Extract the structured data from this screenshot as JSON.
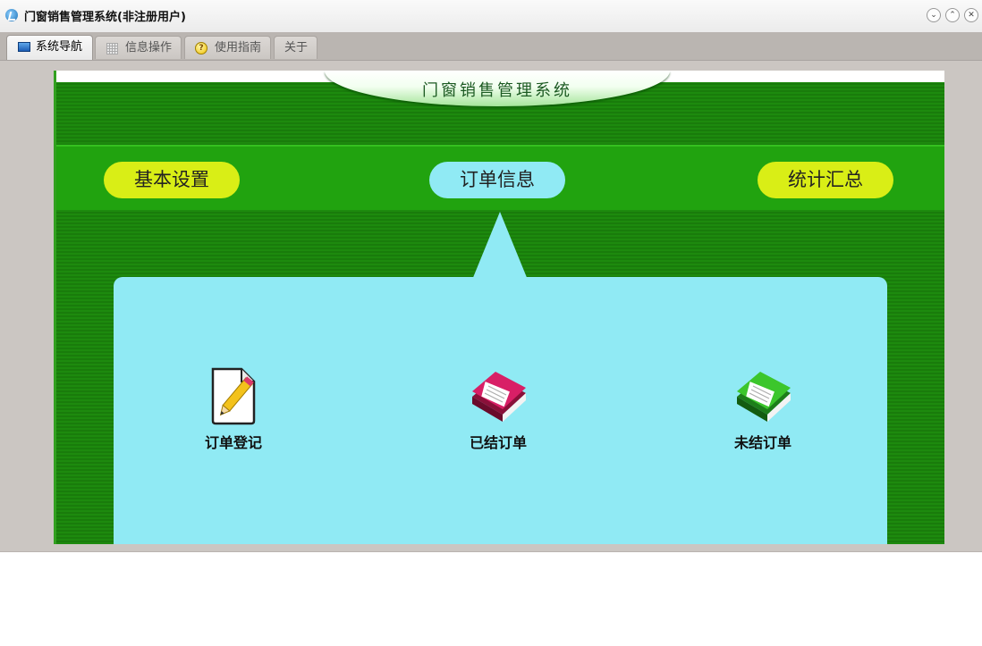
{
  "window": {
    "title": "门窗销售管理系统(非注册用户)"
  },
  "window_controls": [
    {
      "name": "minimize",
      "glyph": "⌄"
    },
    {
      "name": "maximize",
      "glyph": "⌃"
    },
    {
      "name": "close",
      "glyph": "✕"
    }
  ],
  "tabs": [
    {
      "label": "系统导航",
      "icon": "monitor-icon",
      "active": true
    },
    {
      "label": "信息操作",
      "icon": "grid-icon",
      "active": false
    },
    {
      "label": "使用指南",
      "icon": "help-icon",
      "active": false
    },
    {
      "label": "关于",
      "icon": "",
      "active": false
    }
  ],
  "banner": {
    "title": "门窗销售管理系统"
  },
  "nav": [
    {
      "label": "基本设置",
      "color": "#d9ee16"
    },
    {
      "label": "订单信息",
      "color": "#90eaf4",
      "selected": true
    },
    {
      "label": "统计汇总",
      "color": "#d9ee16"
    }
  ],
  "items": [
    {
      "label": "订单登记",
      "icon": "edit-document-icon"
    },
    {
      "label": "已结订单",
      "icon": "red-book-icon"
    },
    {
      "label": "未结订单",
      "icon": "green-book-icon"
    }
  ],
  "colors": {
    "panel_green": "#1d8a0e",
    "nav_band": "#21a30f",
    "accent_cyan": "#90eaf4",
    "accent_yellow": "#d9ee16"
  }
}
